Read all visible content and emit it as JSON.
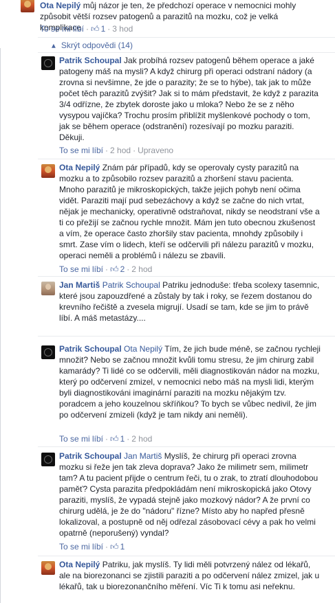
{
  "labels": {
    "like": "To se mi líbí",
    "sep": "·",
    "edited": "Upraveno",
    "hide_replies": "Skrýt odpovědi (14)"
  },
  "top_comment": {
    "author": "Ota Nepilý",
    "text": "můj názor je ten, že předchozí operace v nemocnici mohly způsobit větší rozsev patogenů a parazitů na mozku, což je velká komplikace",
    "likes": "1",
    "time": "3 hod"
  },
  "replies": [
    {
      "author": "Patrik Schoupal",
      "mention": "",
      "text": "Jak probíhá rozsev patogenů během operace a jaké patogeny máš na mysli? A když chirurg při operaci odstraní nádory (a zrovna si nevšimne, že jde o parazity; že se to hýbe), tak jak to může počet těch parazitů zvýšit? Jak si to mám představit, že když z parazita 3/4 odřízne, že zbytek doroste jako u mloka? Nebo že se z něho vysypou vajíčka? Trochu prosím přiblížit myšlenkové pochody o tom, jak se během operace (odstranění) rozesívají po mozku paraziti. Děkuji.",
      "likes": "",
      "time": "2 hod",
      "edited": true
    },
    {
      "author": "Ota Nepilý",
      "mention": "",
      "text": "Znám pár případů, kdy se operovaly cysty parazitů na mozku a to způsobilo rozsev parazitů a zhoršení stavu pacienta. Mnoho parazitů je mikroskopických, takže jejich pohyb není očima vidět. Paraziti mají pud sebezáchovy a když se začne do nich vrtat, nějak je mechanicky, operativně odstraňovat, nikdy se neodstraní vše a ti co přežijí se začnou rychle množit. Mám jen tuto obecnou zkušenost a vím, že operace často zhoršily stav pacienta, mnohdy způsobily i smrt. Zase vím o lidech, kteří se odčervili při nálezu parazitů v mozku, operaci neměli a problémů i nálezu se zbavili.",
      "likes": "2",
      "time": "2 hod",
      "edited": false
    },
    {
      "author": "Jan Martiš",
      "mention": "Patrik Schoupal",
      "text": "Patriku jednoduše: třeba scolexy tasemnic, které jsou zapouzdřené a zůstaly by tak i roky, se řezem dostanou do krevního řečiště a zvesela migrují. Usadí se tam, kde se jim to právě líbí. A máš metastázy....",
      "likes": "",
      "time": "",
      "edited": false
    },
    {
      "author": "Patrik Schoupal",
      "mention": "Ota Nepilý",
      "text": "Tím, že jich bude méně, se začnou rychleji množit? Nebo se začnou množit kvůli tomu stresu, že jim chirurg zabil kamarády? Ti lidé co se odčervili, měli diagnostikován nádor na mozku, který po odčervení zmizel, v nemocnici nebo máš na mysli lidi, kterým byli diagnostikováni imaginární paraziti na mozku nějakým tzv. poradcem a jeho kouzelnou skříňkou? To bych se vůbec nedivil, že jim po odčervení zmizeli (když je tam nikdy ani neměli).",
      "likes": "1",
      "time": "2 hod",
      "edited": false
    },
    {
      "author": "Patrik Schoupal",
      "mention": "Jan Martiš",
      "text": "Myslíš, že chirurg při operaci zrovna mozku si řeže jen tak zleva doprava? Jako že milimetr sem, milimetr tam? A tu pacient přijde o centrum řeči, tu o zrak, to ztratí dlouhodobou paměť? Cysta parazita předpokládám není mikroskopická jako Otovy paraziti, myslíš, že vypadá stejně jako mozkový nádor? A že první co chirurg udělá, je že do \"nádoru\" řízne? Místo aby ho napřed přesně lokalizoval, a postupně od něj odřezal zásobovací cévy a pak ho velmi opatrně (neporušený) vyndal?",
      "likes": "1",
      "time": "",
      "edited": false
    },
    {
      "author": "Ota Nepilý",
      "mention": "",
      "text": "Patriku, jak myslíš. Ty lidi měli potvrzený nález od lékařů, ale na biorezonanci se zjistili paraziti a po odčervení nález zmizel, jak u lékařů, tak u biorezonančního měření. Víc Ti k tomu asi neřeknu.",
      "likes": "",
      "time": "",
      "edited": false
    }
  ],
  "icons": {
    "like": "thumbs-up-icon",
    "toggle": "chevron-up-icon"
  },
  "colors": {
    "name": "#365899",
    "link": "#4b67a1",
    "meta": "#90949c",
    "text": "#1d2129",
    "divider": "#e9ebee"
  }
}
